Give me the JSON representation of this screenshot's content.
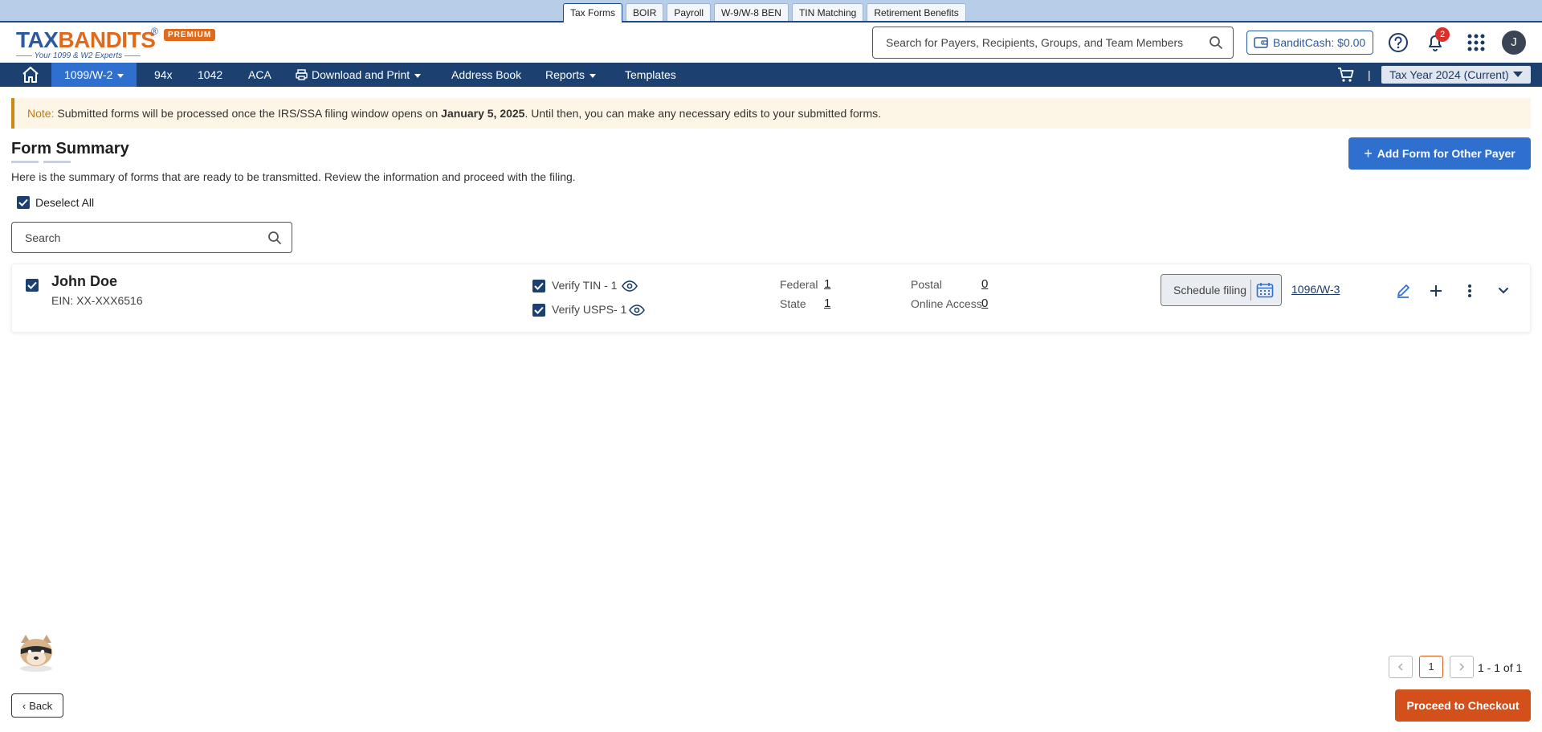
{
  "product_tabs": [
    "Tax Forms",
    "BOIR",
    "Payroll",
    "W-9/W-8 BEN",
    "TIN Matching",
    "Retirement Benefits"
  ],
  "active_product_tab": "Tax Forms",
  "logo": {
    "brand_left": "TAX",
    "brand_oo": "BANDITS",
    "registered": "®",
    "tagline": "—— Your 1099 & W2 Experts ——",
    "edition": "PREMIUM"
  },
  "header": {
    "search_placeholder": "Search for Payers, Recipients, Groups, and Team Members",
    "banditcash_label": "BanditCash: $0.00",
    "notification_count": "2",
    "avatar_initial": "J"
  },
  "nav": {
    "items": [
      "1099/W-2",
      "94x",
      "1042",
      "ACA",
      "Download and Print",
      "Address Book",
      "Reports",
      "Templates"
    ],
    "separator": "|",
    "tax_year": "Tax Year 2024 (Current)"
  },
  "note": {
    "label": "Note:",
    "text_before": " Submitted forms will be processed once the IRS/SSA filing window opens on ",
    "date": "January 5, 2025",
    "text_after": ". Until then, you can make any necessary edits to your submitted forms."
  },
  "summary": {
    "title": "Form Summary",
    "description": "Here is the summary of forms that are ready to be transmitted. Review the information and proceed with the filing.",
    "add_button": "Add Form for Other Payer",
    "deselect_all": "Deselect All",
    "search_placeholder": "Search"
  },
  "payer": {
    "name": "John Doe",
    "ein": "EIN: XX-XXX6516",
    "verify_tin": "Verify TIN - 1",
    "verify_usps": "Verify USPS- 1",
    "federal_label": "Federal",
    "federal_count": "1",
    "state_label": "State",
    "state_count": "1",
    "postal_label": "Postal",
    "postal_count": "0",
    "online_label": "Online Access",
    "online_count": "0",
    "schedule_label": "Schedule filing",
    "form_link": "1096/W-3"
  },
  "pagination": {
    "current_page": "1",
    "info": "1 - 1 of 1"
  },
  "footer": {
    "back": "Back",
    "checkout": "Proceed to Checkout"
  },
  "colors": {
    "nav_bg": "#1c4170",
    "primary_blue": "#2f6fce",
    "checkout_orange": "#d4501a",
    "note_bg": "#fdf6e6",
    "note_accent": "#c98a16"
  }
}
